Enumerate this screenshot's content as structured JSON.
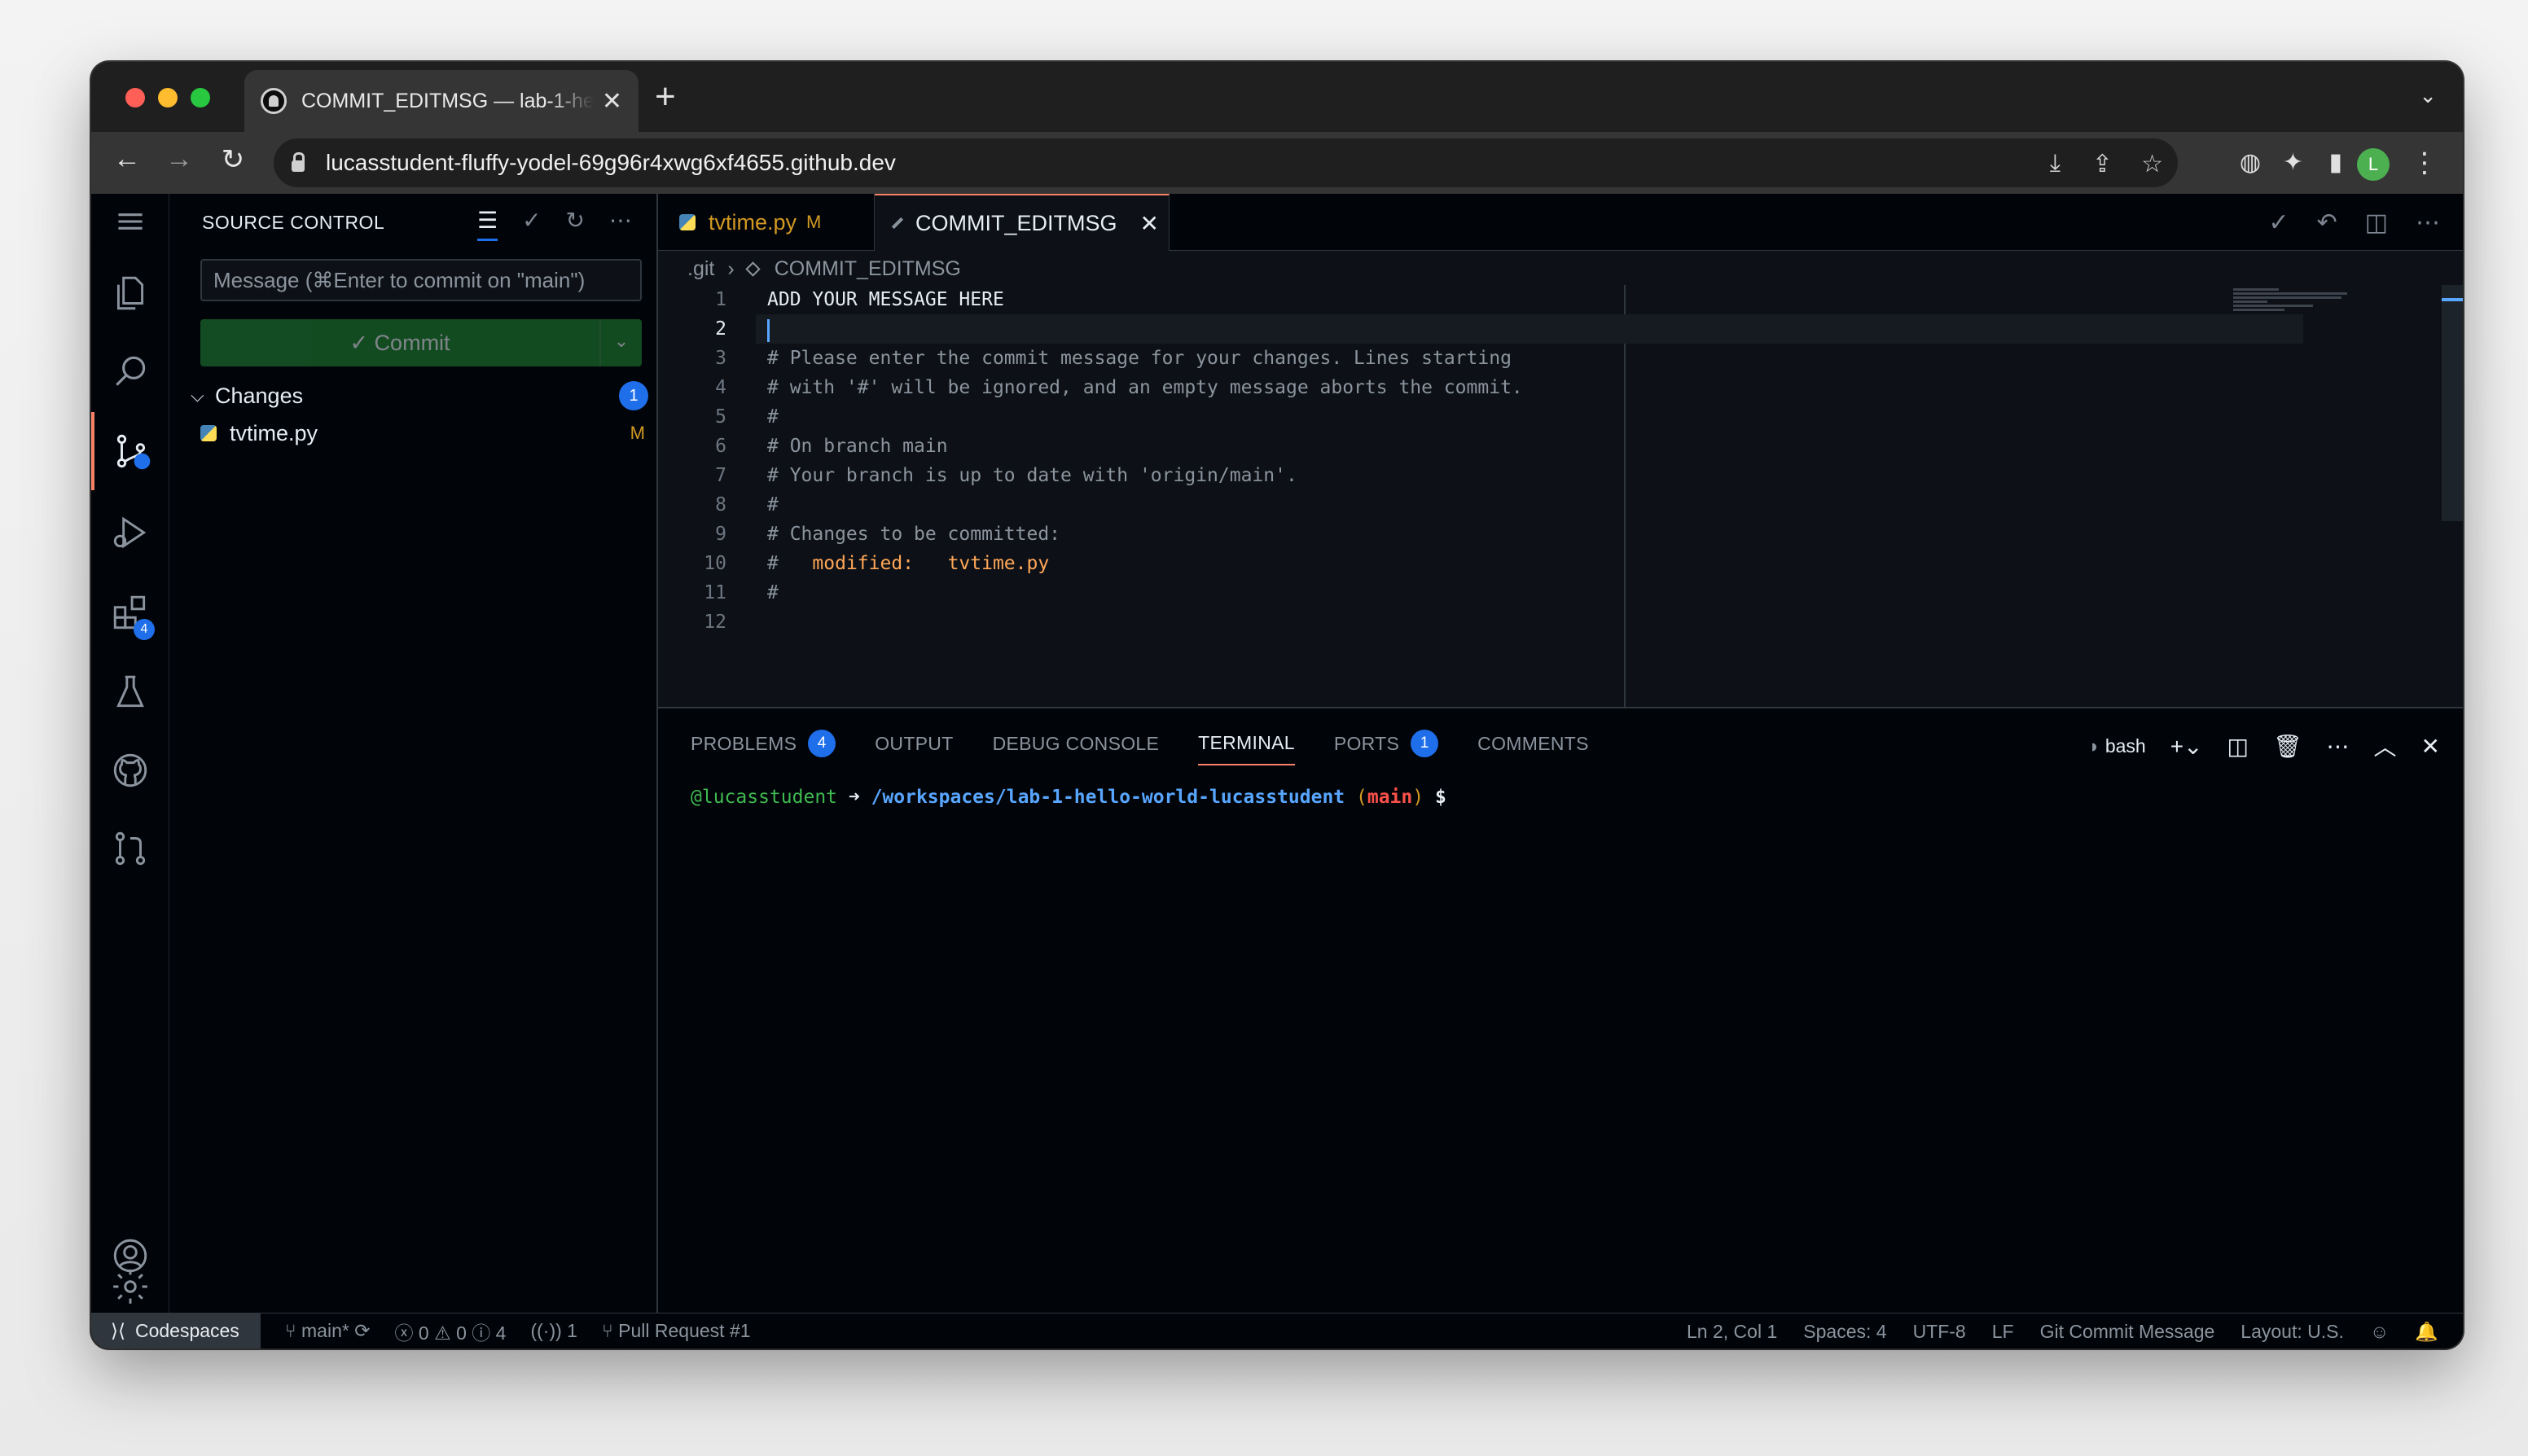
{
  "browser": {
    "tab_title": "COMMIT_EDITMSG — lab-1-he",
    "tab_close": "✕",
    "new_tab": "+",
    "url": "lucasstudent-fluffy-yodel-69g96r4xwg6xf4655.github.dev",
    "profile_initial": "L"
  },
  "sidebar": {
    "title": "SOURCE CONTROL",
    "message_placeholder": "Message (⌘Enter to commit on \"main\")",
    "commit_label": "✓ Commit",
    "changes_label": "Changes",
    "changes_count": "1",
    "files": [
      {
        "name": "tvtime.py",
        "status": "M"
      }
    ]
  },
  "activity": {
    "extensions_badge": "4"
  },
  "editor": {
    "tabs": [
      {
        "label": "tvtime.py",
        "status": "M"
      },
      {
        "label": "COMMIT_EDITMSG",
        "close": "✕"
      }
    ],
    "breadcrumb": [
      ".git",
      "COMMIT_EDITMSG"
    ],
    "lines": [
      {
        "n": "1",
        "text": "ADD YOUR MESSAGE HERE"
      },
      {
        "n": "2",
        "text": ""
      },
      {
        "n": "3",
        "text": "# Please enter the commit message for your changes. Lines starting"
      },
      {
        "n": "4",
        "text": "# with '#' will be ignored, and an empty message aborts the commit."
      },
      {
        "n": "5",
        "text": "#"
      },
      {
        "n": "6",
        "text": "# On branch main"
      },
      {
        "n": "7",
        "text": "# Your branch is up to date with 'origin/main'."
      },
      {
        "n": "8",
        "text": "#"
      },
      {
        "n": "9",
        "text": "# Changes to be committed:"
      },
      {
        "n": "10",
        "text": "#",
        "kw": "   modified:   tvtime.py"
      },
      {
        "n": "11",
        "text": "#"
      },
      {
        "n": "12",
        "text": ""
      }
    ]
  },
  "panel": {
    "tabs": [
      {
        "label": "PROBLEMS",
        "badge": "4"
      },
      {
        "label": "OUTPUT"
      },
      {
        "label": "DEBUG CONSOLE"
      },
      {
        "label": "TERMINAL"
      },
      {
        "label": "PORTS",
        "badge": "1"
      },
      {
        "label": "COMMENTS"
      }
    ],
    "shell": "bash",
    "terminal": {
      "user": "@lucasstudent",
      "arrow": " ➜ ",
      "path": "/workspaces/lab-1-hello-world-lucasstudent",
      "open_paren": " (",
      "branch": "main",
      "close_paren": ")",
      "prompt": " $"
    }
  },
  "statusbar": {
    "remote": "Codespaces",
    "branch": "main*",
    "errors": "0",
    "warnings": "0",
    "infos": "4",
    "ports": "1",
    "pull_request": "Pull Request #1",
    "position": "Ln 2, Col 1",
    "spaces": "Spaces: 4",
    "encoding": "UTF-8",
    "eol": "LF",
    "language": "Git Commit Message",
    "layout": "Layout: U.S."
  },
  "colors": {
    "accent": "#1f6feb",
    "active_tab_border": "#f78166",
    "modified": "#d29922",
    "commit_button": "#238636"
  }
}
